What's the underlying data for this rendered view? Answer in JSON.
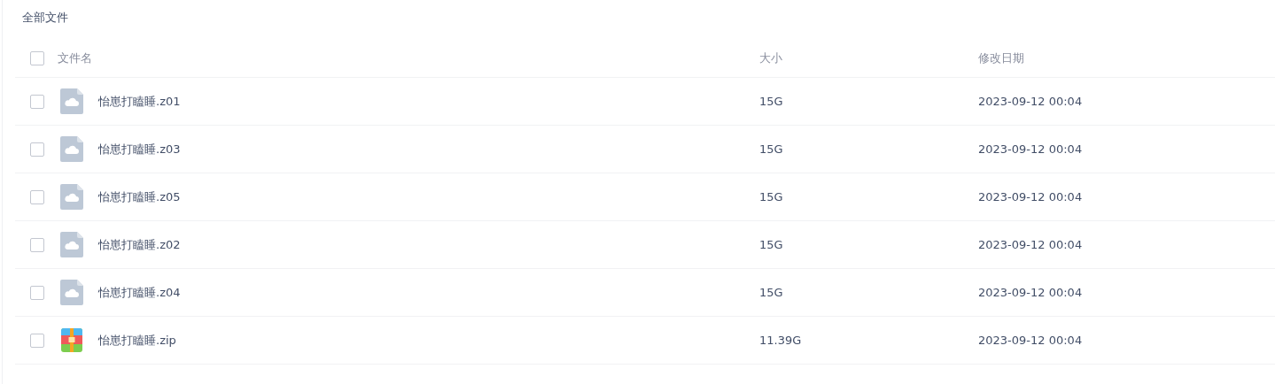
{
  "breadcrumb": "全部文件",
  "table": {
    "select_all_checked": false,
    "columns": [
      "文件名",
      "大小",
      "修改日期"
    ],
    "rows": [
      {
        "kind": "cloud",
        "checked": false,
        "name": "怡崽打瞌睡.z01",
        "size": "15G",
        "modified": "2023-09-12 00:04"
      },
      {
        "kind": "cloud",
        "checked": false,
        "name": "怡崽打瞌睡.z03",
        "size": "15G",
        "modified": "2023-09-12 00:04"
      },
      {
        "kind": "cloud",
        "checked": false,
        "name": "怡崽打瞌睡.z05",
        "size": "15G",
        "modified": "2023-09-12 00:04"
      },
      {
        "kind": "cloud",
        "checked": false,
        "name": "怡崽打瞌睡.z02",
        "size": "15G",
        "modified": "2023-09-12 00:04"
      },
      {
        "kind": "cloud",
        "checked": false,
        "name": "怡崽打瞌睡.z04",
        "size": "15G",
        "modified": "2023-09-12 00:04"
      },
      {
        "kind": "zip",
        "checked": false,
        "name": "怡崽打瞌睡.zip",
        "size": "11.39G",
        "modified": "2023-09-12 00:04"
      }
    ]
  }
}
